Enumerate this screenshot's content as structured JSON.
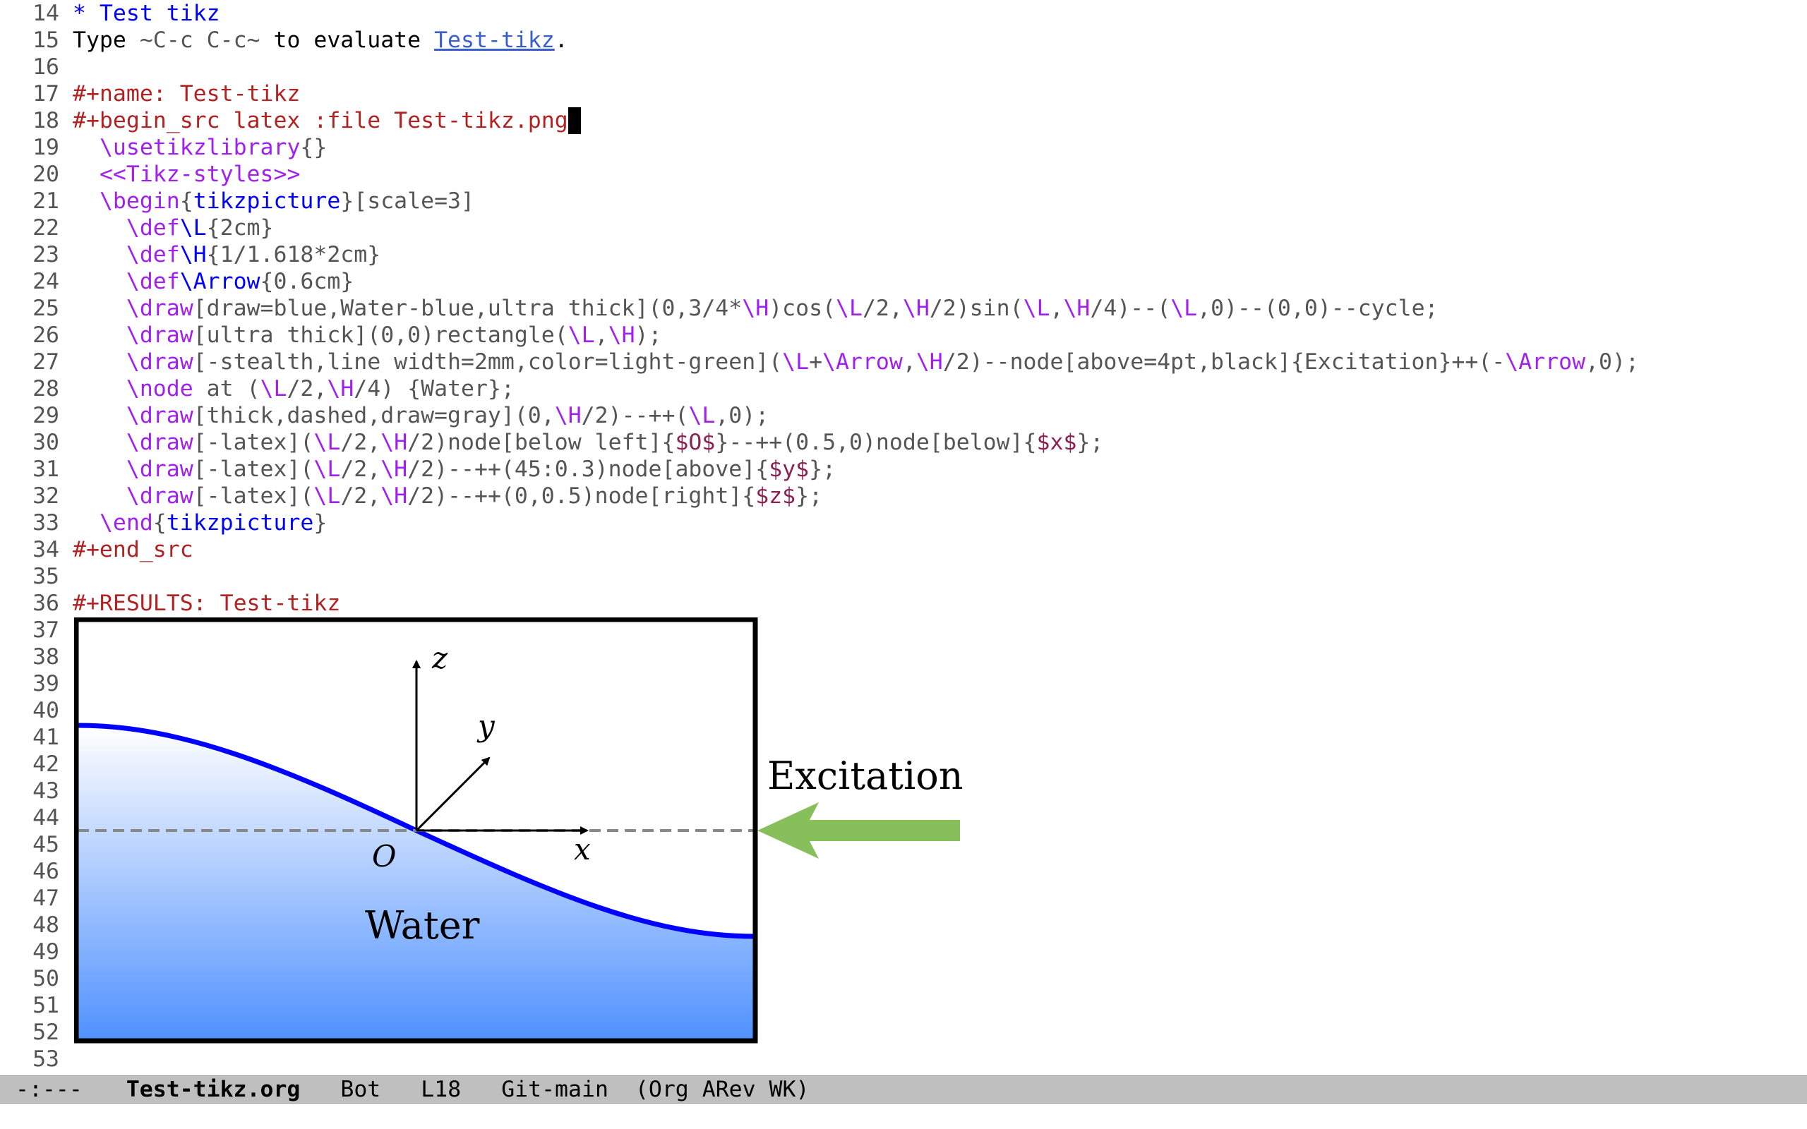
{
  "editor": {
    "line_numbers": [
      "14",
      "15",
      "16",
      "17",
      "18",
      "19",
      "20",
      "21",
      "22",
      "23",
      "24",
      "25",
      "26",
      "27",
      "28",
      "29",
      "30",
      "31",
      "32",
      "33",
      "34",
      "35",
      "36",
      "37",
      "38",
      "39",
      "40",
      "41",
      "42",
      "43",
      "44",
      "45",
      "46",
      "47",
      "48",
      "49",
      "50",
      "51",
      "52",
      "53"
    ],
    "heading": "* Test tikz",
    "instruction": {
      "prefix": "Type ",
      "keys": "~C-c C-c~",
      "middle": " to evaluate ",
      "link": "Test-tikz",
      "suffix": "."
    },
    "name_line": "#+name: Test-tikz",
    "begin_src": "#+begin_src latex :file Test-tikz.png",
    "code": {
      "l19": {
        "cmd": "\\usetikzlibrary",
        "rest": "{}"
      },
      "l20": {
        "noweb": "<<Tikz-styles>>"
      },
      "l21": {
        "cmd": "\\begin",
        "o": "{",
        "env": "tikzpicture",
        "rest": "}[scale=3]"
      },
      "l22": {
        "cmd": "\\def",
        "arg": "\\L",
        "rest": "{2cm}"
      },
      "l23": {
        "cmd": "\\def",
        "arg": "\\H",
        "rest": "{1/1.618*2cm}"
      },
      "l24": {
        "cmd": "\\def",
        "arg": "\\Arrow",
        "rest": "{0.6cm}"
      },
      "l25": [
        "\\draw",
        "[draw=blue,Water-blue,ultra thick](0,3/4*",
        "\\H",
        ")cos(",
        "\\L",
        "/2,",
        "\\H",
        "/2)sin(",
        "\\L",
        ",",
        "\\H",
        "/4)--(",
        "\\L",
        ",0)--(0,0)--cycle;"
      ],
      "l26": [
        "\\draw",
        "[ultra thick](0,0)rectangle(",
        "\\L",
        ",",
        "\\H",
        ");"
      ],
      "l27": [
        "\\draw",
        "[-stealth,line width=2mm,color=light-green](",
        "\\L",
        "+",
        "\\Arrow",
        ",",
        "\\H",
        "/2)--node[above=4pt,black]{Excitation}++(-",
        "\\Arrow",
        ",0);"
      ],
      "l28": [
        "\\node",
        " at (",
        "\\L",
        "/2,",
        "\\H",
        "/4) {Water};"
      ],
      "l29": [
        "\\draw",
        "[thick,dashed,draw=gray](0,",
        "\\H",
        "/2)--++(",
        "\\L",
        ",0);"
      ],
      "l30": [
        "\\draw",
        "[-latex](",
        "\\L",
        "/2,",
        "\\H",
        "/2)node[below left]{",
        "$O$",
        "}--++(0.5,0)node[below]{",
        "$x$",
        "};"
      ],
      "l31": [
        "\\draw",
        "[-latex](",
        "\\L",
        "/2,",
        "\\H",
        "/2)--++(45:0.3)node[above]{",
        "$y$",
        "};"
      ],
      "l32": [
        "\\draw",
        "[-latex](",
        "\\L",
        "/2,",
        "\\H",
        "/2)--++(0,0.5)node[right]{",
        "$z$",
        "};"
      ],
      "l33": {
        "cmd": "\\end",
        "o": "{",
        "env": "tikzpicture",
        "rest": "}"
      }
    },
    "end_src": "#+end_src",
    "results": "#+RESULTS: Test-tikz"
  },
  "figure": {
    "labels": {
      "z": "z",
      "y": "y",
      "O": "O",
      "x": "x",
      "water": "Water",
      "excitation": "Excitation"
    },
    "colors": {
      "water_top": "#ffffff",
      "water_bottom": "#4f91ff",
      "curve": "#0000ff",
      "arrow": "#87c05a",
      "dash": "#888888",
      "border": "#000000"
    }
  },
  "mode_line": {
    "state": "-:---",
    "buffer": "Test-tikz.org",
    "position": "Bot",
    "line": "L18",
    "vc": "Git-main",
    "modes": "(Org ARev WK)"
  }
}
